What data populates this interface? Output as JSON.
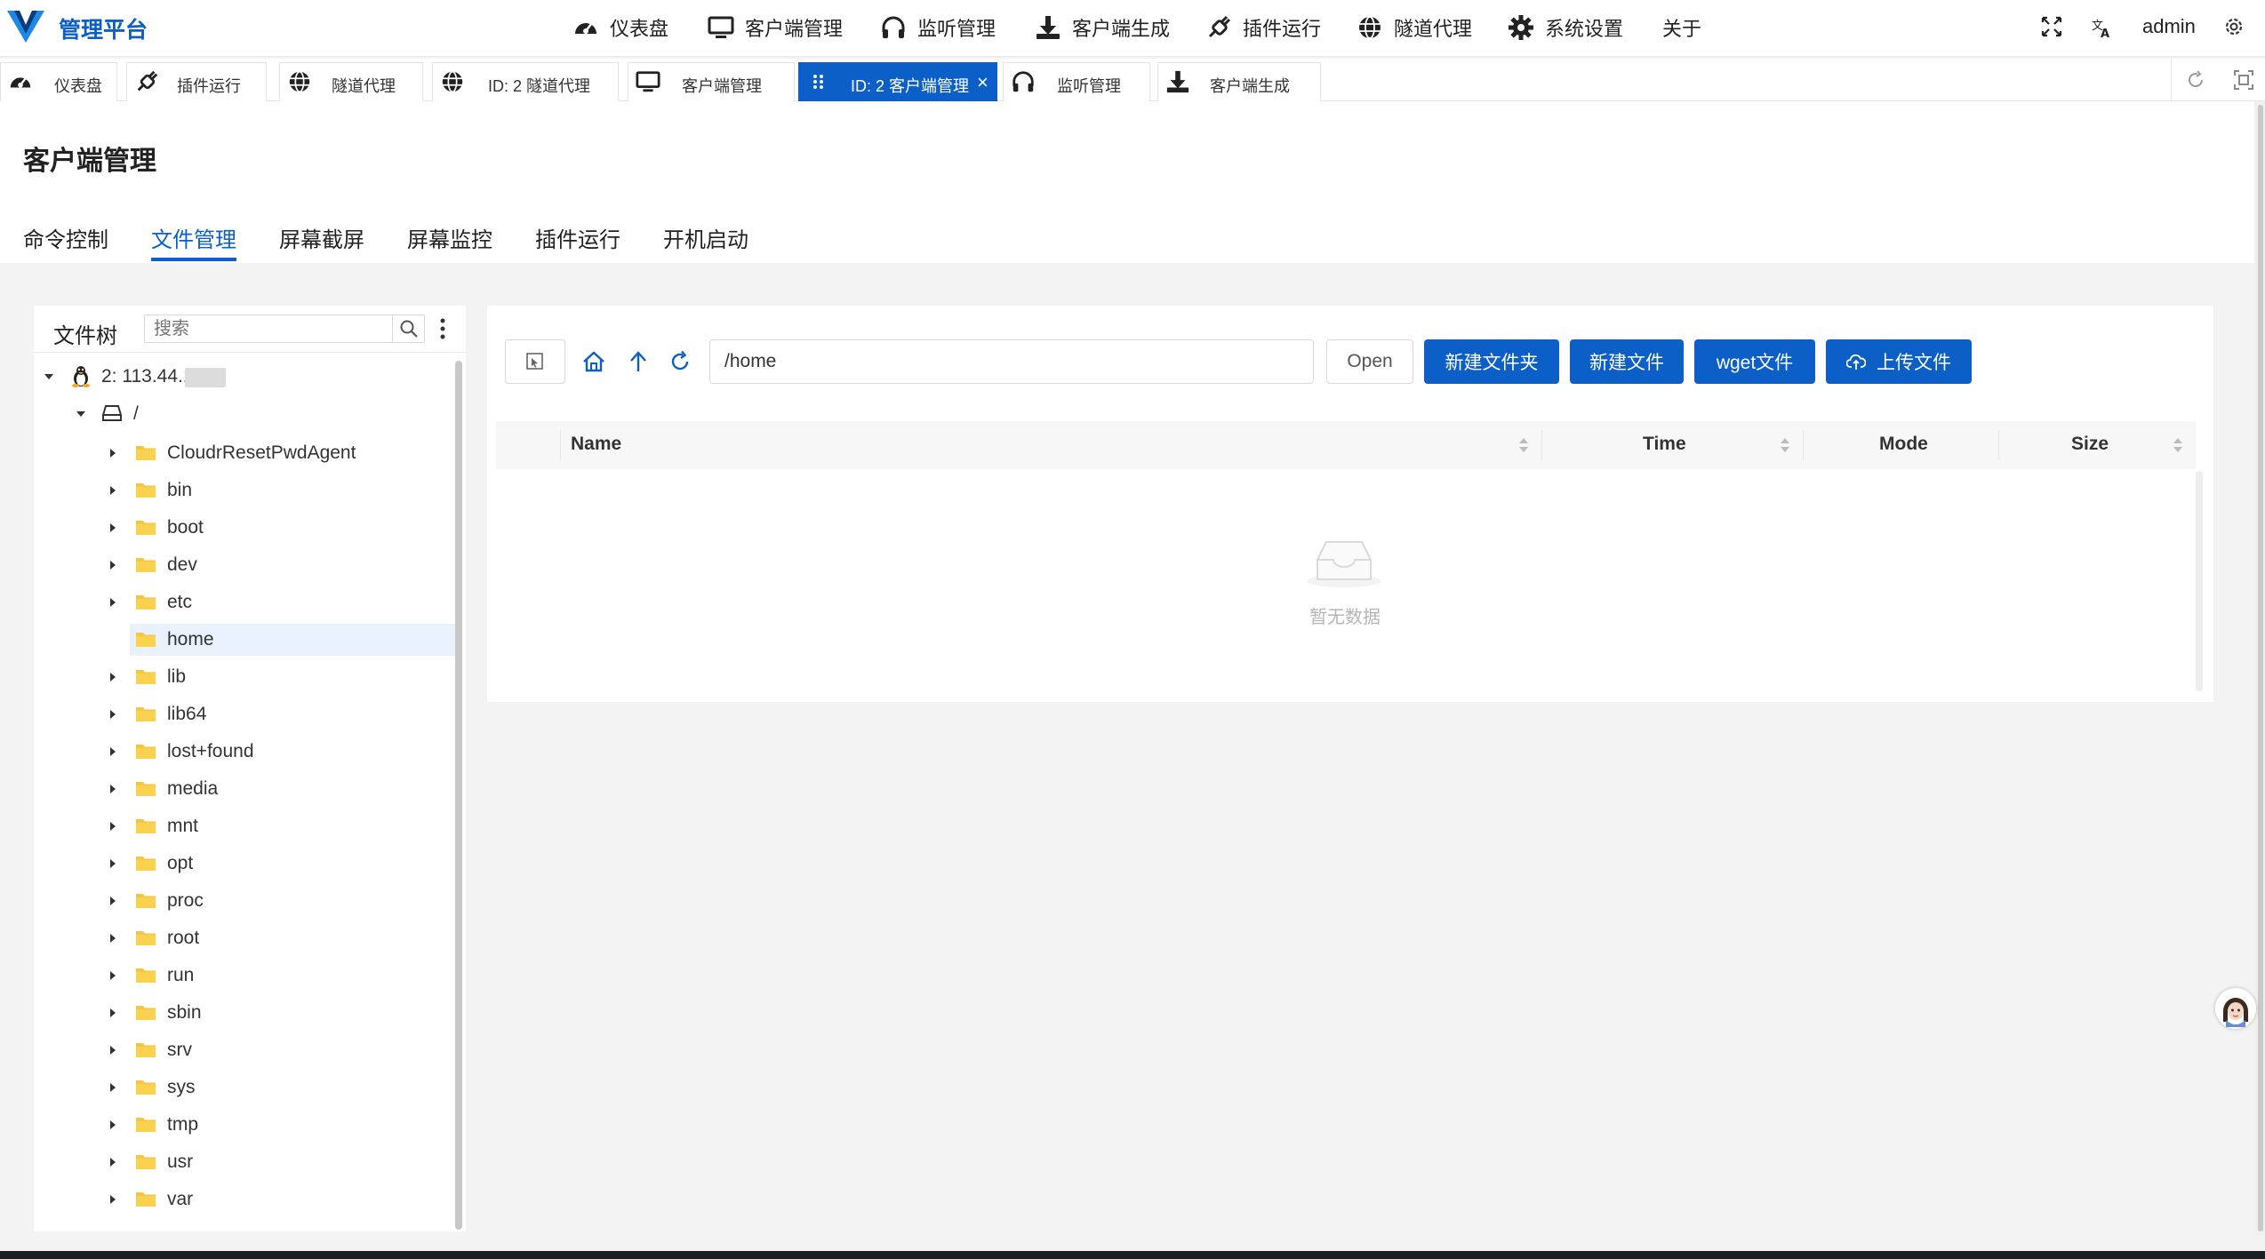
{
  "app": {
    "brand": "管理平台"
  },
  "nav": {
    "items": [
      {
        "label": "仪表盘",
        "icon": "dashboard-icon"
      },
      {
        "label": "客户端管理",
        "icon": "monitor-icon"
      },
      {
        "label": "监听管理",
        "icon": "headphones-icon"
      },
      {
        "label": "客户端生成",
        "icon": "download-icon"
      },
      {
        "label": "插件运行",
        "icon": "plug-icon"
      },
      {
        "label": "隧道代理",
        "icon": "globe-icon"
      },
      {
        "label": "系统设置",
        "icon": "gear-icon"
      },
      {
        "label": "关于",
        "icon": ""
      }
    ],
    "user": "admin"
  },
  "tabs": [
    {
      "label": "仪表盘",
      "icon": "dashboard-icon"
    },
    {
      "label": "插件运行",
      "icon": "plug-icon"
    },
    {
      "label": "隧道代理",
      "icon": "globe-icon"
    },
    {
      "label": "ID: 2 隧道代理",
      "icon": "globe-icon"
    },
    {
      "label": "客户端管理",
      "icon": "monitor-icon"
    },
    {
      "label": "ID: 2 客户端管理",
      "icon": "drag-handle-icon",
      "active": true,
      "close": "×"
    },
    {
      "label": "监听管理",
      "icon": "headphones-icon"
    },
    {
      "label": "客户端生成",
      "icon": "download-icon"
    }
  ],
  "page": {
    "title": "客户端管理",
    "subtabs": [
      "命令控制",
      "文件管理",
      "屏幕截屏",
      "屏幕监控",
      "插件运行",
      "开机启动"
    ],
    "active_subtab": "文件管理"
  },
  "tree": {
    "title": "文件树",
    "search_placeholder": "搜索",
    "root_label": "2: 113.44.1",
    "drive_label": "/",
    "selected": "home",
    "folders": [
      "CloudrResetPwdAgent",
      "bin",
      "boot",
      "dev",
      "etc",
      "home",
      "lib",
      "lib64",
      "lost+found",
      "media",
      "mnt",
      "opt",
      "proc",
      "root",
      "run",
      "sbin",
      "srv",
      "sys",
      "tmp",
      "usr",
      "var"
    ]
  },
  "files": {
    "path": "/home",
    "buttons": {
      "open": "Open",
      "new_folder": "新建文件夹",
      "new_file": "新建文件",
      "wget": "wget文件",
      "upload": "上传文件"
    },
    "columns": [
      "Name",
      "Time",
      "Mode",
      "Size"
    ],
    "empty_text": "暂无数据"
  }
}
